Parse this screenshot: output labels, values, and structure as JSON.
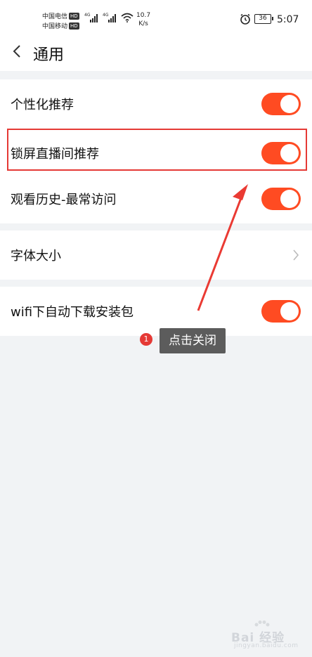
{
  "status_bar": {
    "carrier_1": "中国电信",
    "carrier_2": "中国移动",
    "hd_badge": "HD",
    "network_1": "4G",
    "network_2": "4G",
    "speed_value": "10.7",
    "speed_unit": "K/s",
    "battery": "36",
    "time": "5:07"
  },
  "header": {
    "title": "通用"
  },
  "settings": {
    "personalized_recommend": {
      "label": "个性化推荐",
      "enabled": true
    },
    "lockscreen_live_recommend": {
      "label": "锁屏直播间推荐",
      "enabled": true
    },
    "watch_history": {
      "label": "观看历史-最常访问",
      "enabled": true
    },
    "font_size": {
      "label": "字体大小"
    },
    "wifi_auto_download": {
      "label": "wifi下自动下载安装包",
      "enabled": true
    }
  },
  "annotation": {
    "step_number": "1",
    "tip_text": "点击关闭"
  },
  "watermark": {
    "brand": "Bai 经验",
    "url": "jingyan.baidu.com"
  },
  "colors": {
    "toggle_on": "#ff4b22",
    "highlight": "#e53935",
    "tooltip_bg": "#5c5c5c",
    "background": "#f1f3f5"
  }
}
